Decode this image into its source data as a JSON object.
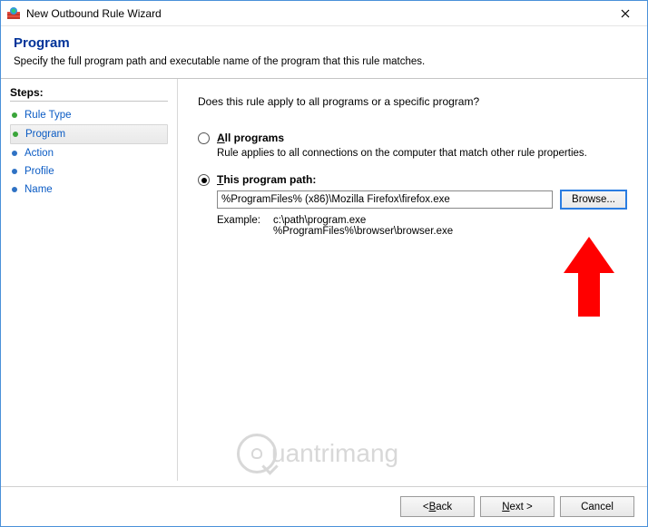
{
  "window": {
    "title": "New Outbound Rule Wizard"
  },
  "header": {
    "title": "Program",
    "subtitle": "Specify the full program path and executable name of the program that this rule matches."
  },
  "sidebar": {
    "heading": "Steps:",
    "items": [
      {
        "label": "Rule Type",
        "state": "completed"
      },
      {
        "label": "Program",
        "state": "current"
      },
      {
        "label": "Action",
        "state": "pending"
      },
      {
        "label": "Profile",
        "state": "pending"
      },
      {
        "label": "Name",
        "state": "pending"
      }
    ]
  },
  "main": {
    "question": "Does this rule apply to all programs or a specific program?",
    "option_all": {
      "title_pre": "",
      "title_ul": "A",
      "title_post": "ll programs",
      "desc": "Rule applies to all connections on the computer that match other rule properties.",
      "selected": false
    },
    "option_path": {
      "title_pre": "",
      "title_ul": "T",
      "title_post": "his program path:",
      "selected": true,
      "value": "%ProgramFiles% (x86)\\Mozilla Firefox\\firefox.exe",
      "browse_label": "Browse...",
      "example_label": "Example:",
      "example_lines": "c:\\path\\program.exe\n%ProgramFiles%\\browser\\browser.exe"
    }
  },
  "footer": {
    "back_pre": "< ",
    "back_ul": "B",
    "back_post": "ack",
    "next_pre": "",
    "next_ul": "N",
    "next_post": "ext >",
    "cancel": "Cancel"
  },
  "watermark": {
    "text": "uantrimang"
  }
}
